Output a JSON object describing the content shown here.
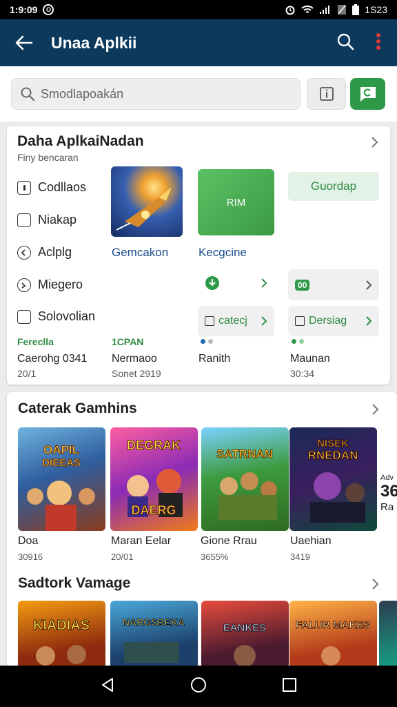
{
  "status": {
    "time": "1:9:09",
    "notif_badge": "O",
    "right_time": "1S23"
  },
  "appbar": {
    "title": "Unaa Aplkii"
  },
  "search": {
    "placeholder": "Smodlapoakán"
  },
  "section1": {
    "title": "Daha AplkaiNadan",
    "subtitle": "Finy bencaran",
    "checkboxes": [
      {
        "label": "Codllaos"
      },
      {
        "label": "Niakap"
      },
      {
        "label": "Aclplg"
      },
      {
        "label": "Miegero"
      },
      {
        "label": "Solovolian"
      }
    ],
    "tiles": [
      {
        "label": "Gemcakon",
        "overlay": ""
      },
      {
        "label": "Kecgcine",
        "overlay": "RIM"
      },
      {
        "label": "",
        "overlay": "Guordap"
      }
    ],
    "pills": [
      {
        "label": "",
        "icon": "download-icon"
      },
      {
        "label": "",
        "badge": "00"
      },
      {
        "label": "catecj"
      },
      {
        "label": "Dersiag"
      }
    ],
    "meta": [
      {
        "tag": "Fereclla",
        "name": "Caerohg 0341",
        "date": "20/1"
      },
      {
        "tag": "1CPAN",
        "name": "Nermaoo",
        "date": "Sonet 2919"
      },
      {
        "tag": "",
        "name": "Ranith",
        "date": ""
      },
      {
        "tag": "",
        "name": "Maunan",
        "date": "30:34"
      }
    ]
  },
  "section2": {
    "title": "Caterak Gamhins",
    "games": [
      {
        "art_text": "OAPIL DIEEAS",
        "title": "Doa",
        "sub": "30916"
      },
      {
        "art_text": "DEGRAK DAERG",
        "title": "Maran Eelar",
        "sub": "20/01"
      },
      {
        "art_text": "SATRNAN",
        "title": "Gione Rrau",
        "sub": "3655%"
      },
      {
        "art_text": "NISEK RNEDAN",
        "title": "Uaehian",
        "sub": "3419"
      }
    ],
    "peek": {
      "top": "Adv",
      "num": "36",
      "bottom": "Ra"
    }
  },
  "section3": {
    "title": "Sadtork Vamage",
    "games": [
      {
        "art_text": "KIADIAS"
      },
      {
        "art_text": "NARGSBEKA"
      },
      {
        "art_text": "EANKES"
      },
      {
        "art_text": "FALUR MAKES"
      }
    ]
  },
  "colors": {
    "appbar": "#0d3a5c",
    "accent_green": "#2e9a48",
    "link_blue": "#1a4d8c"
  }
}
